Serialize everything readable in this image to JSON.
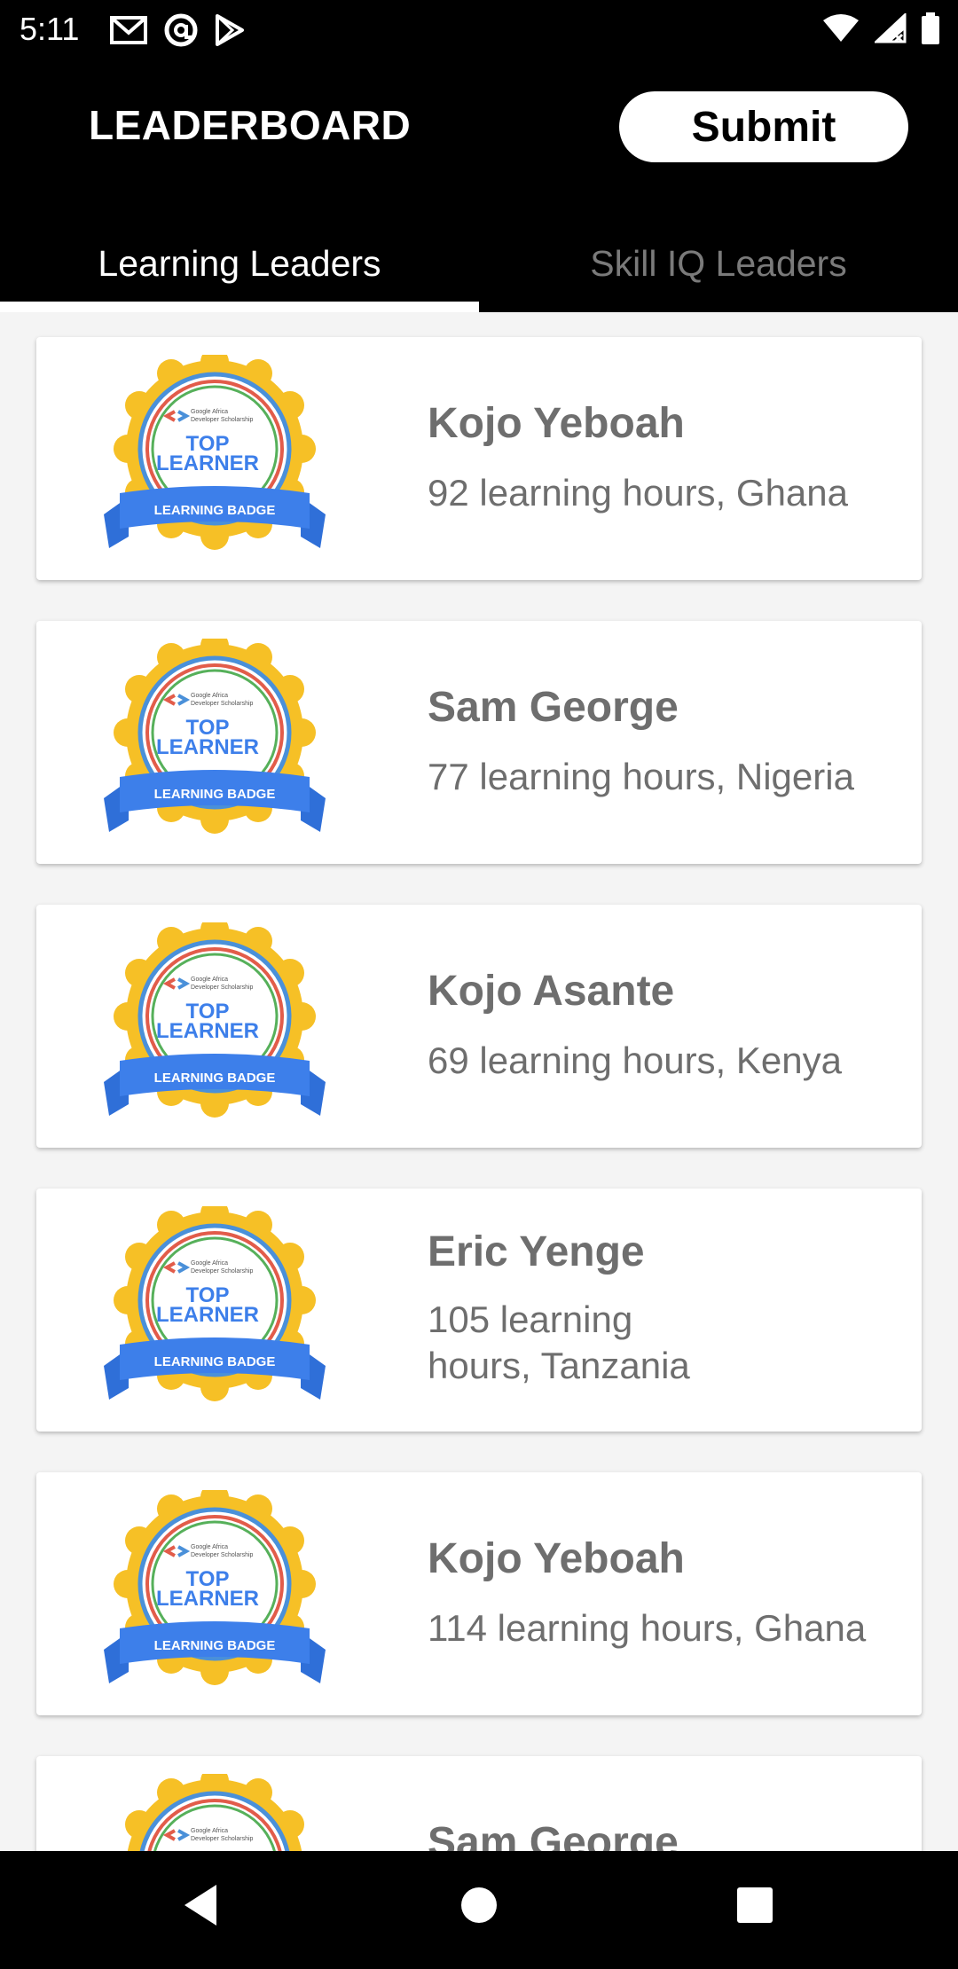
{
  "status_bar": {
    "time": "5:11",
    "left_icons": [
      "gmail-icon",
      "at-sign-icon",
      "play-store-icon"
    ],
    "right_icons": [
      "wifi-icon",
      "signal-icon",
      "battery-icon"
    ]
  },
  "header": {
    "title": "LEADERBOARD",
    "submit_label": "Submit"
  },
  "tabs": [
    {
      "label": "Learning Leaders",
      "active": true
    },
    {
      "label": "Skill IQ Leaders",
      "active": false
    }
  ],
  "badge": {
    "brand_line1": "Google Africa",
    "brand_line2": "Developer Scholarship",
    "top": "TOP",
    "learner": "LEARNER",
    "ribbon": "LEARNING BADGE"
  },
  "leaders": [
    {
      "name": "Kojo Yeboah",
      "detail": "92 learning hours, Ghana"
    },
    {
      "name": "Sam George",
      "detail": "77 learning hours, Nigeria"
    },
    {
      "name": "Kojo Asante",
      "detail": "69 learning hours, Kenya"
    },
    {
      "name": "Eric Yenge",
      "detail": "105 learning hours, Tanzania"
    },
    {
      "name": "Kojo Yeboah",
      "detail": "114 learning hours, Ghana"
    },
    {
      "name": "Sam George",
      "detail": ""
    }
  ],
  "nav_bar": {
    "buttons": [
      "back-icon",
      "home-icon",
      "recents-icon"
    ]
  },
  "colors": {
    "app_bar": "#000000",
    "badge_gold": "#F6C026",
    "badge_blue": "#3D7FEA",
    "text_gray": "#6E6E6E"
  }
}
